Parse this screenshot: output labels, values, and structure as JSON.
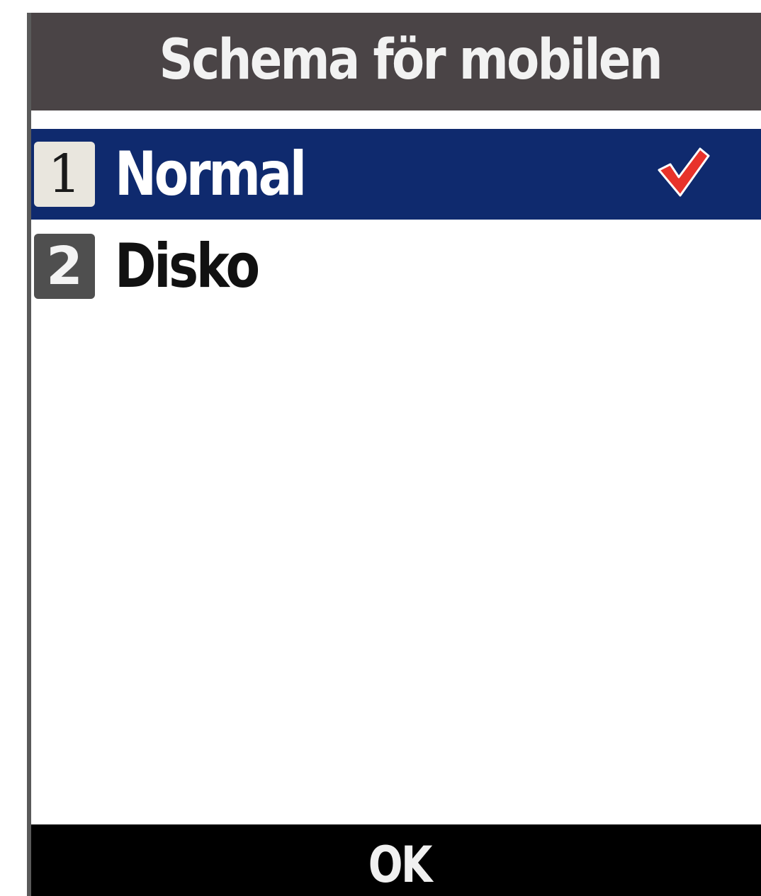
{
  "header": {
    "title": "Schema för mobilen"
  },
  "menu": {
    "items": [
      {
        "number": "1",
        "label": "Normal",
        "selected": true,
        "checked": true,
        "check_icon": "checkmark-icon"
      },
      {
        "number": "2",
        "label": "Disko",
        "selected": false,
        "checked": false
      }
    ]
  },
  "softkeys": {
    "center_label": "OK"
  },
  "colors": {
    "title_bar": "#4a4446",
    "selection": "#0f2a6e",
    "check": "#e8322a",
    "softkey_bar": "#000000"
  }
}
